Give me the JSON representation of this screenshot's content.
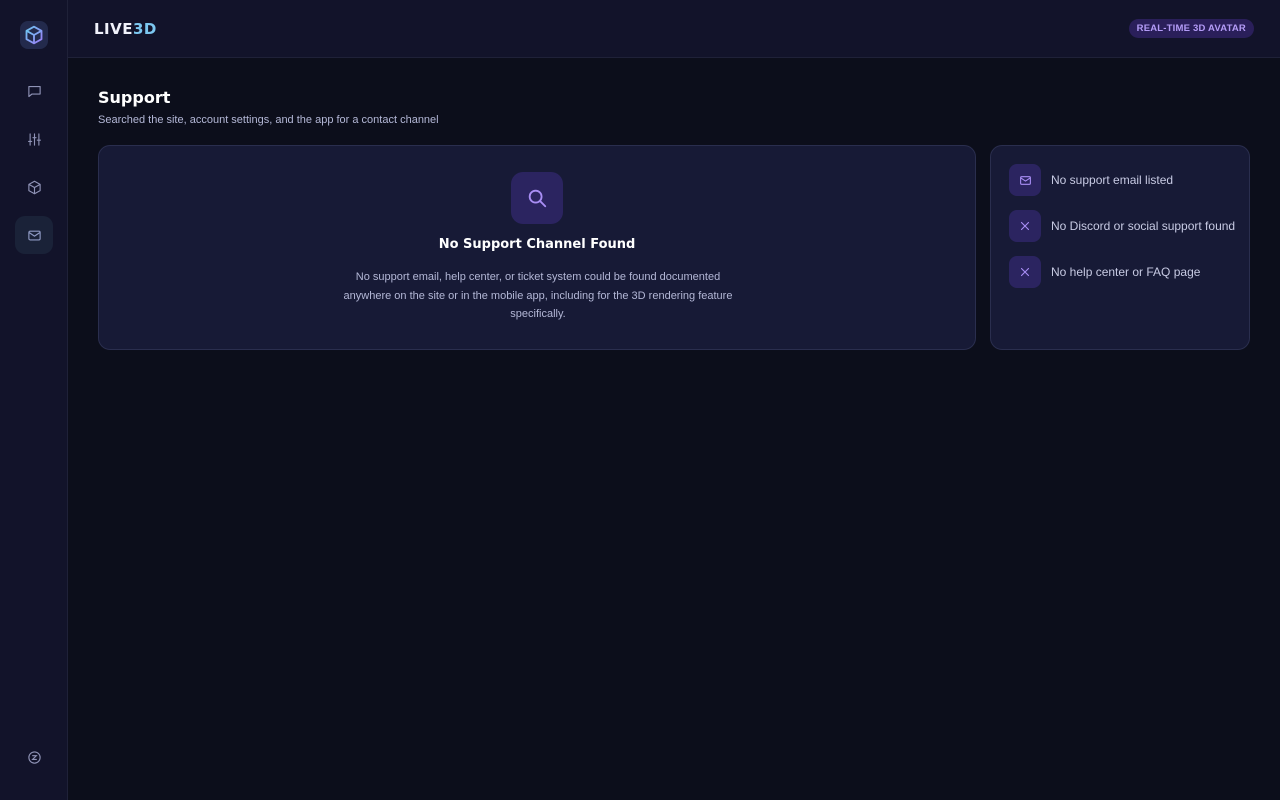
{
  "header": {
    "brand_prefix": "LIVE",
    "brand_accent": "3D",
    "badge": "REAL-TIME 3D AVATAR"
  },
  "sidebar": {
    "items": [
      {
        "icon": "chat-bubble-icon"
      },
      {
        "icon": "sliders-icon"
      },
      {
        "icon": "cube-icon"
      },
      {
        "icon": "mail-icon",
        "active": true
      }
    ],
    "bottom_icon": "coin-icon"
  },
  "page": {
    "title": "Support",
    "subtitle": "Searched the site, account settings, and the app for a contact channel"
  },
  "empty_state": {
    "icon": "search-icon",
    "title": "No Support Channel Found",
    "description": "No support email, help center, or ticket system could be found documented anywhere on the site or in the mobile app, including for the 3D rendering feature specifically."
  },
  "findings": [
    {
      "icon": "mail-icon",
      "label": "No support email listed"
    },
    {
      "icon": "close-icon",
      "label": "No Discord or social support found"
    },
    {
      "icon": "close-icon",
      "label": "No help center or FAQ page"
    }
  ],
  "colors": {
    "background": "#0c0e1b",
    "panel": "#12132a",
    "card": "#171a36",
    "accent_purple": "#a98ef5",
    "accent_blue": "#7cc7f0"
  }
}
